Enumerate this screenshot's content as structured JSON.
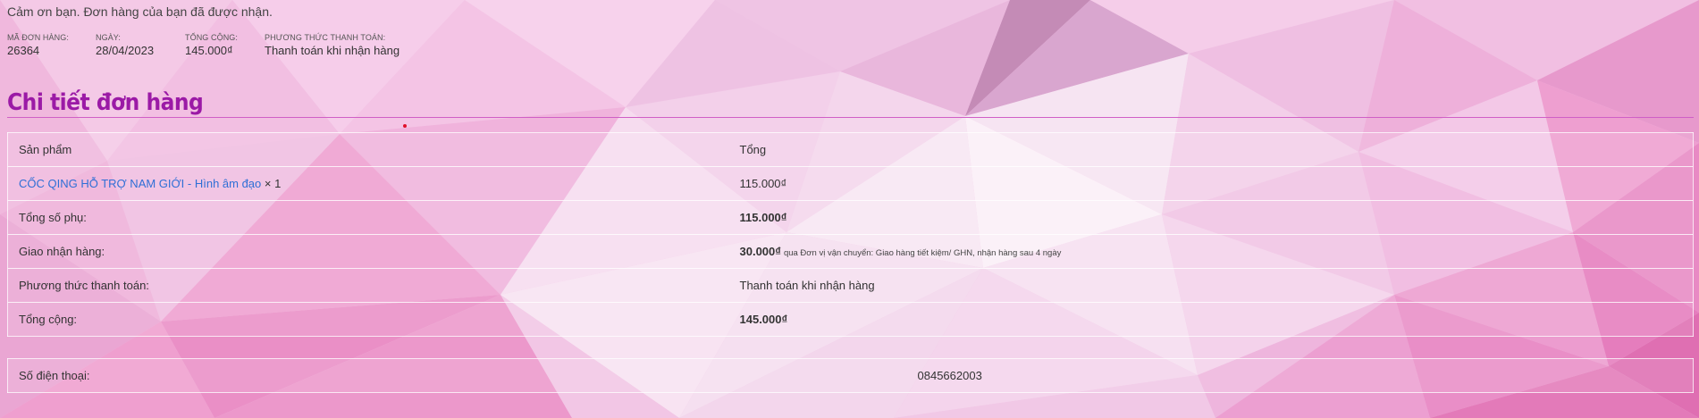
{
  "thanks_message": "Cảm ơn bạn. Đơn hàng của bạn đã được nhận.",
  "overview": [
    {
      "label": "Mã đơn hàng:",
      "value": "26364"
    },
    {
      "label": "Ngày:",
      "value": "28/04/2023"
    },
    {
      "label": "Tổng cộng:",
      "value": "145.000₫"
    },
    {
      "label": "Phương thức thanh toán:",
      "value": "Thanh toán khi nhận hàng"
    }
  ],
  "section_title": "Chi tiết đơn hàng",
  "table": {
    "header": {
      "product": "Sản phẩm",
      "total": "Tổng"
    },
    "item": {
      "name": "CỐC QING HỖ TRỢ NAM GIỚI - Hình âm đạo",
      "qty": "× 1",
      "total": "115.000₫"
    },
    "subtotal": {
      "label": "Tổng số phụ:",
      "value": "115.000₫"
    },
    "shipping": {
      "label": "Giao nhận hàng:",
      "value": "30.000₫",
      "note": "qua Đơn vị vận chuyển: Giao hàng tiết kiệm/ GHN, nhận hàng sau 4 ngày"
    },
    "payment": {
      "label": "Phương thức thanh toán:",
      "value": "Thanh toán khi nhận hàng"
    },
    "grand_total": {
      "label": "Tổng cộng:",
      "value": "145.000₫"
    }
  },
  "phone": {
    "label": "Số điện thoại:",
    "value": "0845662003"
  },
  "colors": {
    "title": "#9b1aa6",
    "link": "#2f6fd6",
    "accent_rule": "#d05fc6"
  }
}
